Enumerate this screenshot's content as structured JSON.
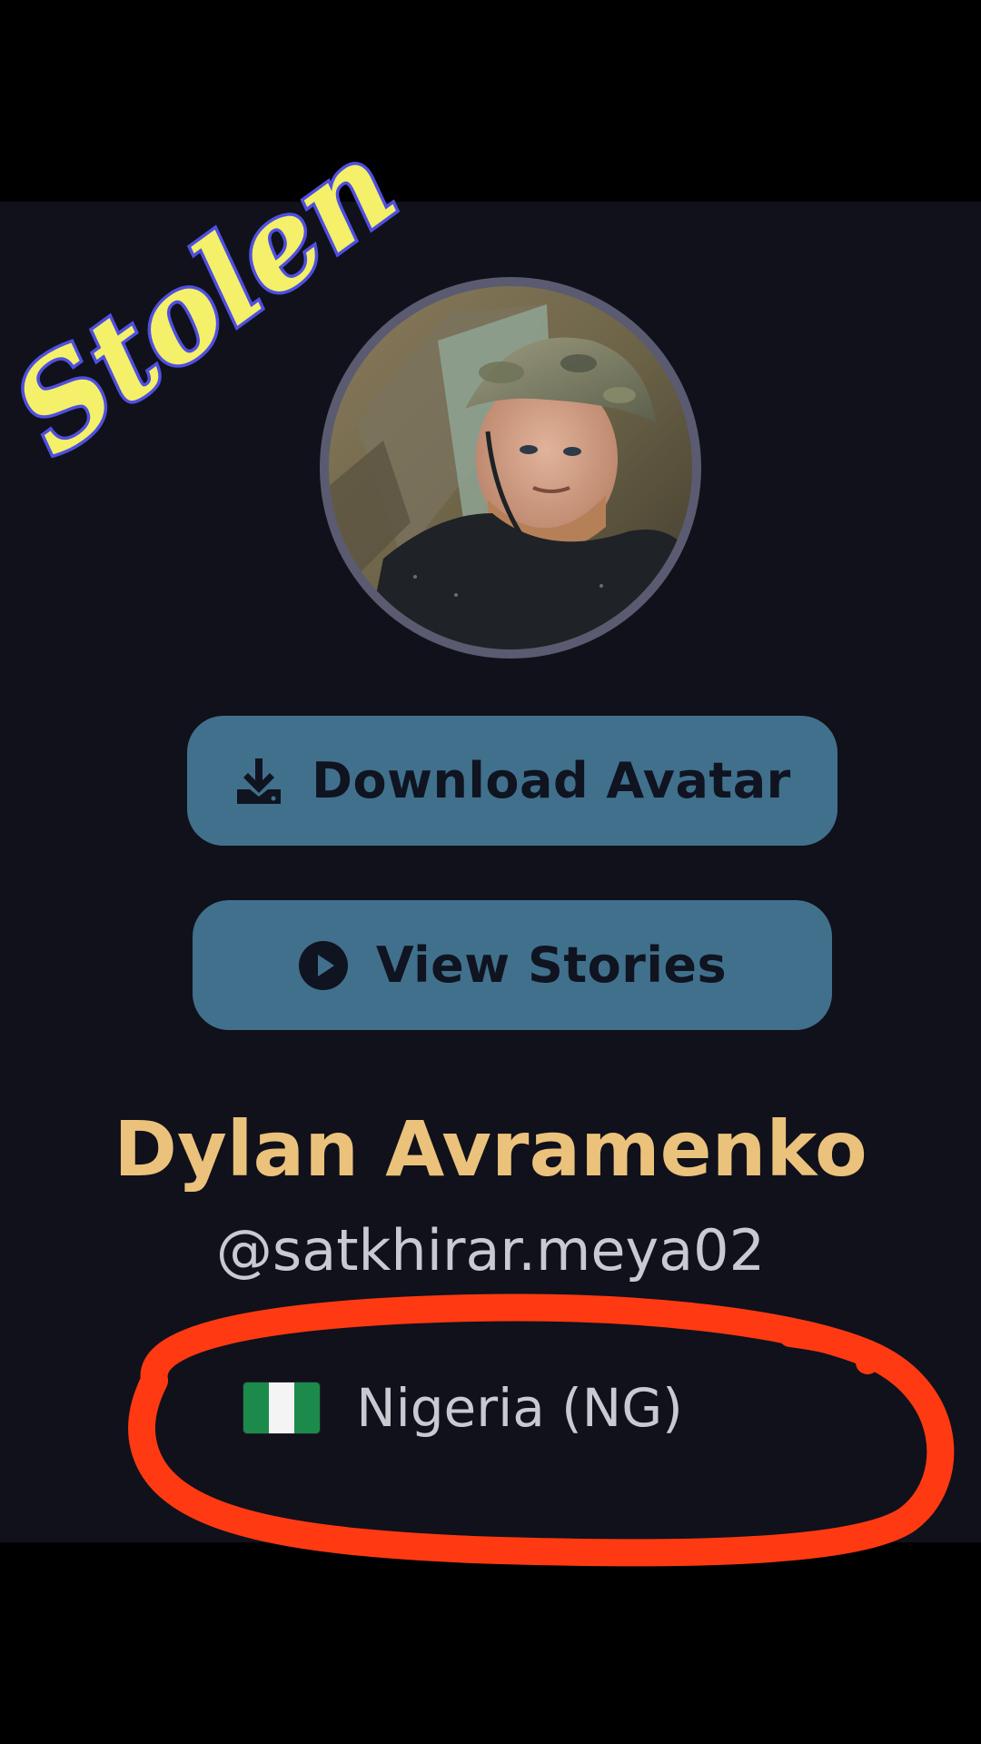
{
  "watermark": {
    "text": "Stolen",
    "fill": "#f4f06a",
    "outline": "#4f4fe0"
  },
  "profile": {
    "display_name": "Dylan Avramenko",
    "username": "@satkhirar.meya02",
    "country": "Nigeria (NG)",
    "flag_icon": "nigeria-flag-icon",
    "name_color": "#ebc27c"
  },
  "actions": {
    "download_avatar_label": "Download Avatar",
    "download_icon": "download-icon",
    "view_stories_label": "View Stories",
    "play_icon": "play-circle-icon",
    "button_color": "#41708c"
  },
  "annotation": {
    "color": "#ff3a12",
    "shape": "hand-drawn circle around country"
  }
}
